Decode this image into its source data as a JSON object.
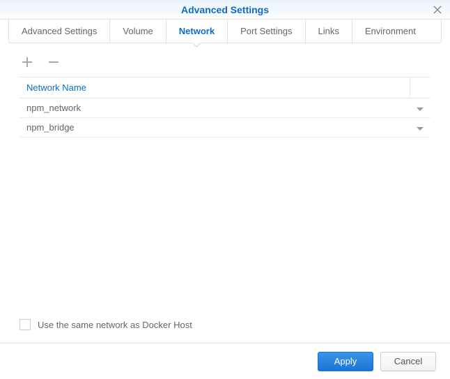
{
  "header": {
    "title": "Advanced Settings"
  },
  "tabs": [
    {
      "label": "Advanced Settings",
      "active": false
    },
    {
      "label": "Volume",
      "active": false
    },
    {
      "label": "Network",
      "active": true
    },
    {
      "label": "Port Settings",
      "active": false
    },
    {
      "label": "Links",
      "active": false
    },
    {
      "label": "Environment",
      "active": false
    }
  ],
  "table": {
    "header": "Network Name",
    "rows": [
      {
        "name": "npm_network"
      },
      {
        "name": "npm_bridge"
      }
    ]
  },
  "checkbox": {
    "label": "Use the same network as Docker Host",
    "checked": false
  },
  "buttons": {
    "apply": "Apply",
    "cancel": "Cancel"
  }
}
